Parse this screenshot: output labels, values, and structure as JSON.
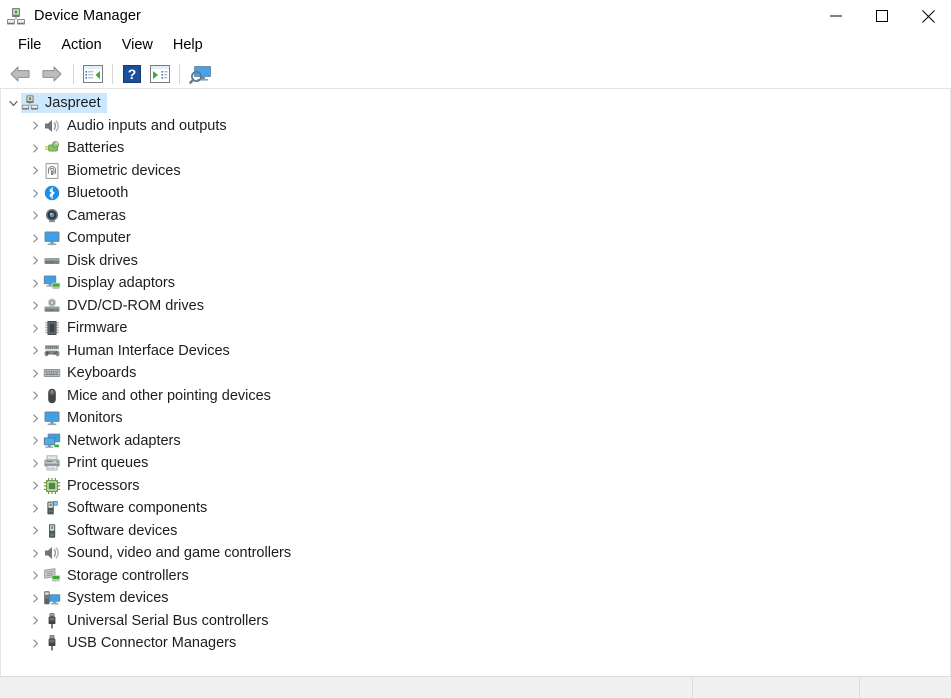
{
  "window": {
    "title": "Device Manager",
    "icon": "device-manager-icon",
    "controls": {
      "minimize": "minimize-icon",
      "maximize": "maximize-icon",
      "close": "close-icon"
    }
  },
  "menubar": {
    "items": [
      {
        "label": "File"
      },
      {
        "label": "Action"
      },
      {
        "label": "View"
      },
      {
        "label": "Help"
      }
    ]
  },
  "toolbar": {
    "buttons": [
      {
        "name": "back-arrow-icon",
        "title": "Back"
      },
      {
        "name": "forward-arrow-icon",
        "title": "Forward"
      },
      {
        "name": "show-hide-console-tree-icon",
        "title": "Show/Hide console tree"
      },
      {
        "name": "help-icon",
        "title": "Help"
      },
      {
        "name": "properties-icon",
        "title": "Properties"
      },
      {
        "name": "scan-for-hardware-changes-icon",
        "title": "Scan for hardware changes"
      }
    ]
  },
  "tree": {
    "root": {
      "label": "Jaspreet",
      "icon": "computer-root-icon",
      "expanded": true,
      "selected": true
    },
    "nodes": [
      {
        "label": "Audio inputs and outputs",
        "icon": "speaker-icon",
        "expanded": false
      },
      {
        "label": "Batteries",
        "icon": "battery-icon",
        "expanded": false
      },
      {
        "label": "Biometric devices",
        "icon": "fingerprint-icon",
        "expanded": false
      },
      {
        "label": "Bluetooth",
        "icon": "bluetooth-icon",
        "expanded": false
      },
      {
        "label": "Cameras",
        "icon": "camera-icon",
        "expanded": false
      },
      {
        "label": "Computer",
        "icon": "monitor-icon",
        "expanded": false
      },
      {
        "label": "Disk drives",
        "icon": "disk-drive-icon",
        "expanded": false
      },
      {
        "label": "Display adaptors",
        "icon": "display-adapter-icon",
        "expanded": false
      },
      {
        "label": "DVD/CD-ROM drives",
        "icon": "optical-drive-icon",
        "expanded": false
      },
      {
        "label": "Firmware",
        "icon": "firmware-chip-icon",
        "expanded": false
      },
      {
        "label": "Human Interface Devices",
        "icon": "gamepad-icon",
        "expanded": false
      },
      {
        "label": "Keyboards",
        "icon": "keyboard-icon",
        "expanded": false
      },
      {
        "label": "Mice and other pointing devices",
        "icon": "mouse-icon",
        "expanded": false
      },
      {
        "label": "Monitors",
        "icon": "monitor-icon",
        "expanded": false
      },
      {
        "label": "Network adapters",
        "icon": "network-adapter-icon",
        "expanded": false
      },
      {
        "label": "Print queues",
        "icon": "printer-icon",
        "expanded": false
      },
      {
        "label": "Processors",
        "icon": "processor-icon",
        "expanded": false
      },
      {
        "label": "Software components",
        "icon": "software-component-icon",
        "expanded": false
      },
      {
        "label": "Software devices",
        "icon": "software-device-icon",
        "expanded": false
      },
      {
        "label": "Sound, video and game controllers",
        "icon": "speaker-icon",
        "expanded": false
      },
      {
        "label": "Storage controllers",
        "icon": "storage-controller-icon",
        "expanded": false
      },
      {
        "label": "System devices",
        "icon": "system-device-icon",
        "expanded": false
      },
      {
        "label": "Universal Serial Bus controllers",
        "icon": "usb-icon",
        "expanded": false
      },
      {
        "label": "USB Connector Managers",
        "icon": "usb-icon",
        "expanded": false
      }
    ]
  },
  "statusbar": {
    "cells": [
      "",
      "",
      ""
    ]
  },
  "colors": {
    "selection": "#cce8ff",
    "accent_blue": "#2a7fd4",
    "green": "#3faa35",
    "window_bg": "#ffffff",
    "statusbar_bg": "#f0f0f0"
  }
}
